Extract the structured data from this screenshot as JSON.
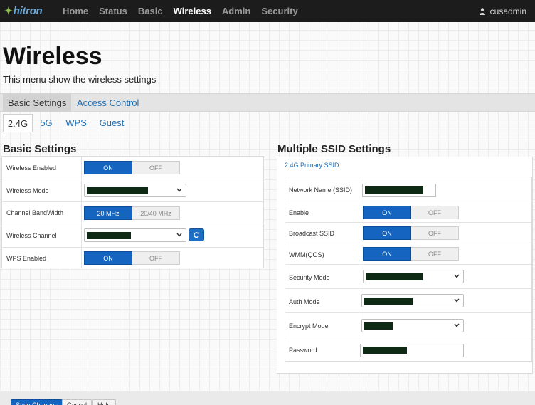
{
  "topbar": {
    "brand": "hitron",
    "nav": [
      "Home",
      "Status",
      "Basic",
      "Wireless",
      "Admin",
      "Security"
    ],
    "active_nav": "Wireless",
    "user": "cusadmin"
  },
  "page": {
    "title": "Wireless",
    "description": "This menu show the wireless settings"
  },
  "subtabs": {
    "active": "Basic Settings",
    "other": "Access Control"
  },
  "bandtabs": [
    "2.4G",
    "5G",
    "WPS",
    "Guest"
  ],
  "basic": {
    "title": "Basic Settings",
    "rows": {
      "wireless_enabled": {
        "label": "Wireless Enabled",
        "on": "ON",
        "off": "OFF"
      },
      "wireless_mode": {
        "label": "Wireless Mode"
      },
      "channel_bandwidth": {
        "label": "Channel BandWidth",
        "opt1": "20 MHz",
        "opt2": "20/40 MHz"
      },
      "wireless_channel": {
        "label": "Wireless Channel"
      },
      "wps_enabled": {
        "label": "WPS Enabled",
        "on": "ON",
        "off": "OFF"
      }
    }
  },
  "ssid": {
    "title": "Multiple SSID Settings",
    "subtitle": "2.4G Primary SSID",
    "rows": {
      "network_name": {
        "label": "Network Name (SSID)"
      },
      "enable": {
        "label": "Enable",
        "on": "ON",
        "off": "OFF"
      },
      "broadcast": {
        "label": "Broadcast SSID",
        "on": "ON",
        "off": "OFF"
      },
      "wmm": {
        "label": "WMM(QOS)",
        "on": "ON",
        "off": "OFF"
      },
      "security_mode": {
        "label": "Security Mode"
      },
      "auth_mode": {
        "label": "Auth Mode"
      },
      "encrypt_mode": {
        "label": "Encrypt Mode"
      },
      "password": {
        "label": "Password"
      }
    }
  },
  "buttons": {
    "save": "Save Changes",
    "cancel": "Cancel",
    "help": "Help"
  },
  "colors": {
    "accent": "#1565c0",
    "topbar": "#1c1c1c",
    "link": "#1f6fb5"
  }
}
